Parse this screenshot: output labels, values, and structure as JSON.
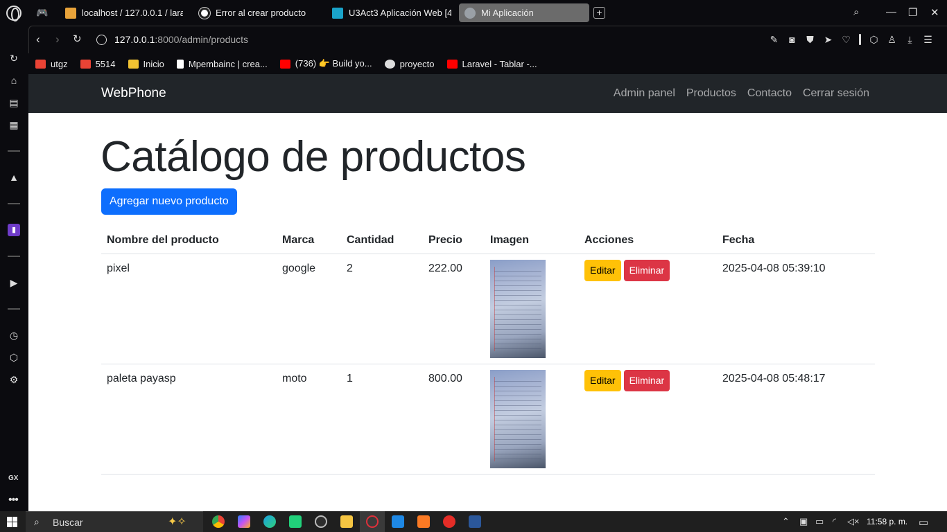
{
  "browser": {
    "tabs": [
      {
        "label": "localhost / 127.0.0.1 / lara",
        "color": "#e8a33a"
      },
      {
        "label": "Error al crear producto",
        "color": "#cccccc"
      },
      {
        "label": "U3Act3 Aplicación Web [4",
        "color": "#1aa3c9"
      },
      {
        "label": "Mi Aplicación",
        "color": "#9aa0a6"
      }
    ],
    "new_tab": "+",
    "url_host": "127.0.0.1",
    "url_rest": ":8000/admin/products",
    "bookmarks": [
      {
        "label": "utgz",
        "color": "#ea4335"
      },
      {
        "label": "5514",
        "color": "#ea4335"
      },
      {
        "label": "Inicio",
        "color": "#f1c232"
      },
      {
        "label": "Mpembainc | crea...",
        "color": "#ffffff"
      },
      {
        "label": "(736) 👉 Build yo...",
        "color": "#ff0000"
      },
      {
        "label": "proyecto",
        "color": "#dddddd"
      },
      {
        "label": "Laravel - Tablar -...",
        "color": "#ff0000"
      }
    ],
    "sidebar_bottom": "GX"
  },
  "app": {
    "brand": "WebPhone",
    "nav": {
      "admin": "Admin panel",
      "products": "Productos",
      "contact": "Contacto",
      "logout": "Cerrar sesión"
    },
    "title": "Catálogo de productos",
    "add_button": "Agregar nuevo producto",
    "table": {
      "headers": [
        "Nombre del producto",
        "Marca",
        "Cantidad",
        "Precio",
        "Imagen",
        "Acciones",
        "Fecha"
      ],
      "rows": [
        {
          "name": "pixel",
          "brand": "google",
          "qty": "2",
          "price": "222.00",
          "edit": "Editar",
          "delete": "Eliminar",
          "date": "2025-04-08 05:39:10"
        },
        {
          "name": "paleta payasp",
          "brand": "moto",
          "qty": "1",
          "price": "800.00",
          "edit": "Editar",
          "delete": "Eliminar",
          "date": "2025-04-08 05:48:17"
        }
      ]
    }
  },
  "taskbar": {
    "search_placeholder": "Buscar",
    "clock": "11:58 p. m."
  }
}
